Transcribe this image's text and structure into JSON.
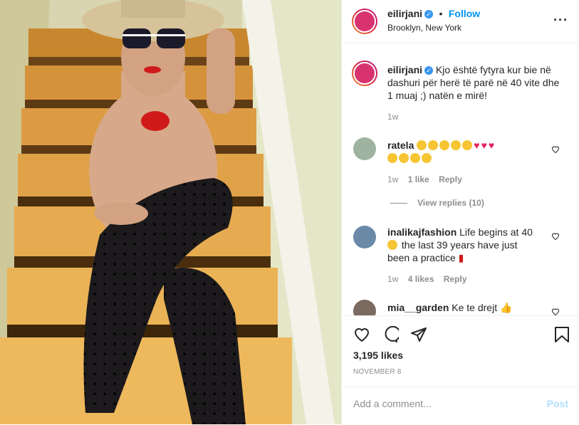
{
  "post": {
    "username": "eilirjani",
    "follow_label": "Follow",
    "location": "Brooklyn, New York",
    "more_icon": "more-icon"
  },
  "caption": {
    "username": "eilirjani",
    "text": "Kjo është fytyra kur bie në dashuri për herë të parë në 40 vite dhe 1 muaj ;) natën e mirë!",
    "time": "1w"
  },
  "comments": [
    {
      "username": "ratela",
      "text": "",
      "time": "1w",
      "likes": "1 like",
      "reply": "Reply"
    },
    {
      "username": "inalikajfashion",
      "text_part1": "Life begins at 40",
      "text_part2": "the last 39 years have just been a practice",
      "time": "1w",
      "likes": "4 likes",
      "reply": "Reply"
    },
    {
      "username": "mia__garden",
      "text": "Ke te drejt"
    }
  ],
  "view_replies": "View replies (10)",
  "likes": "3,195 likes",
  "date": "NOVEMBER 8",
  "add_comment": {
    "placeholder": "Add a comment...",
    "post_label": "Post"
  },
  "colors": {
    "accent": "#0095f6",
    "heart": "#e0245e"
  }
}
